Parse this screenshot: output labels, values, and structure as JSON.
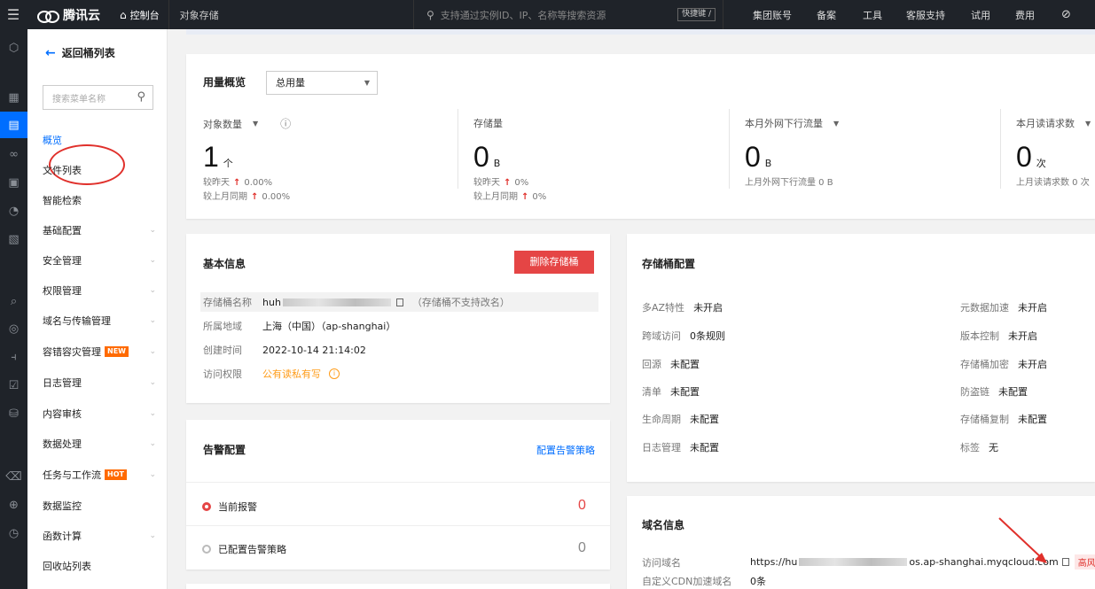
{
  "topbar": {
    "brand": "腾讯云",
    "console": "控制台",
    "product": "对象存储",
    "search_placeholder": "支持通过实例ID、IP、名称等搜索资源",
    "quick_key": "快捷键 /",
    "nav": [
      "集团账号",
      "备案",
      "工具",
      "客服支持",
      "试用",
      "费用"
    ]
  },
  "menu": {
    "back": "返回桶列表",
    "search_placeholder": "搜索菜单名称",
    "items": [
      {
        "label": "概览",
        "active": true
      },
      {
        "label": "文件列表"
      },
      {
        "label": "智能检索"
      },
      {
        "label": "基础配置",
        "expand": true
      },
      {
        "label": "安全管理",
        "expand": true
      },
      {
        "label": "权限管理",
        "expand": true
      },
      {
        "label": "域名与传输管理",
        "expand": true
      },
      {
        "label": "容错容灾管理",
        "badge": "NEW",
        "expand": true
      },
      {
        "label": "日志管理",
        "expand": true
      },
      {
        "label": "内容审核",
        "expand": true
      },
      {
        "label": "数据处理",
        "expand": true
      },
      {
        "label": "任务与工作流",
        "badge": "HOT",
        "expand": true
      },
      {
        "label": "数据监控"
      },
      {
        "label": "函数计算",
        "expand": true
      },
      {
        "label": "回收站列表"
      }
    ]
  },
  "usage": {
    "title": "用量概览",
    "select": "总用量",
    "stats": [
      {
        "label": "对象数量",
        "num": "1",
        "unit": "个",
        "sub1": "较昨天",
        "sub1v": "0.00%",
        "sub2": "较上月同期",
        "sub2v": "0.00%"
      },
      {
        "label": "存储量",
        "num": "0",
        "unit": "B",
        "sub1": "较昨天",
        "sub1v": "0%",
        "sub2": "较上月同期",
        "sub2v": "0%"
      },
      {
        "label": "本月外网下行流量",
        "num": "0",
        "unit": "B",
        "sub1": "上月外网下行流量 0 B"
      },
      {
        "label": "本月读请求数",
        "num": "0",
        "unit": "次",
        "sub1": "上月读请求数 0 次"
      }
    ]
  },
  "basic": {
    "title": "基本信息",
    "delete_btn": "删除存储桶",
    "name_label": "存储桶名称",
    "name_prefix": "huh",
    "name_note": "（存储桶不支持改名）",
    "region_label": "所属地域",
    "region": "上海（中国）（ap-shanghai）",
    "created_label": "创建时间",
    "created": "2022-10-14 21:14:02",
    "acl_label": "访问权限",
    "acl": "公有读私有写"
  },
  "alarm": {
    "title": "告警配置",
    "link": "配置告警策略",
    "current": "当前报警",
    "current_num": "0",
    "configured": "已配置告警策略",
    "configured_num": "0"
  },
  "bucket_cfg": {
    "title": "存储桶配置",
    "left": [
      {
        "k": "多AZ特性",
        "v": "未开启"
      },
      {
        "k": "跨域访问",
        "v": "0条规则"
      },
      {
        "k": "回源",
        "v": "未配置"
      },
      {
        "k": "清单",
        "v": "未配置"
      },
      {
        "k": "生命周期",
        "v": "未配置"
      },
      {
        "k": "日志管理",
        "v": "未配置"
      }
    ],
    "right": [
      {
        "k": "元数据加速",
        "v": "未开启"
      },
      {
        "k": "版本控制",
        "v": "未开启"
      },
      {
        "k": "存储桶加密",
        "v": "未开启"
      },
      {
        "k": "防盗链",
        "v": "未配置"
      },
      {
        "k": "存储桶复制",
        "v": "未配置"
      },
      {
        "k": "标签",
        "v": "无"
      }
    ]
  },
  "domain": {
    "title": "域名信息",
    "access_label": "访问域名",
    "access_prefix": "https://hu",
    "access_suffix": "os.ap-shanghai.myqcloud.com",
    "risk": "高风险",
    "cdn_label": "自定义CDN加速域名",
    "cdn_value": "0条"
  },
  "colors": {
    "accent": "#006eff",
    "danger": "#e54545",
    "warning": "#ff9c19"
  }
}
